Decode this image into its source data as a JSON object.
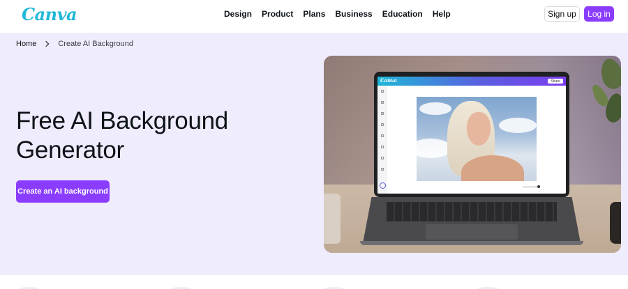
{
  "header": {
    "logo": "Canva",
    "nav": [
      "Design",
      "Product",
      "Plans",
      "Business",
      "Education",
      "Help"
    ],
    "signup_label": "Sign up",
    "login_label": "Log in"
  },
  "breadcrumb": {
    "home": "Home",
    "current": "Create AI Background"
  },
  "hero": {
    "title": "Free AI Background Generator",
    "cta_label": "Create an AI background"
  },
  "screen": {
    "logo": "Canva",
    "share_label": "Share"
  },
  "colors": {
    "brand_purple": "#8b3dff",
    "hero_bg": "#efecfd",
    "logo_teal": "#20b8d8"
  }
}
